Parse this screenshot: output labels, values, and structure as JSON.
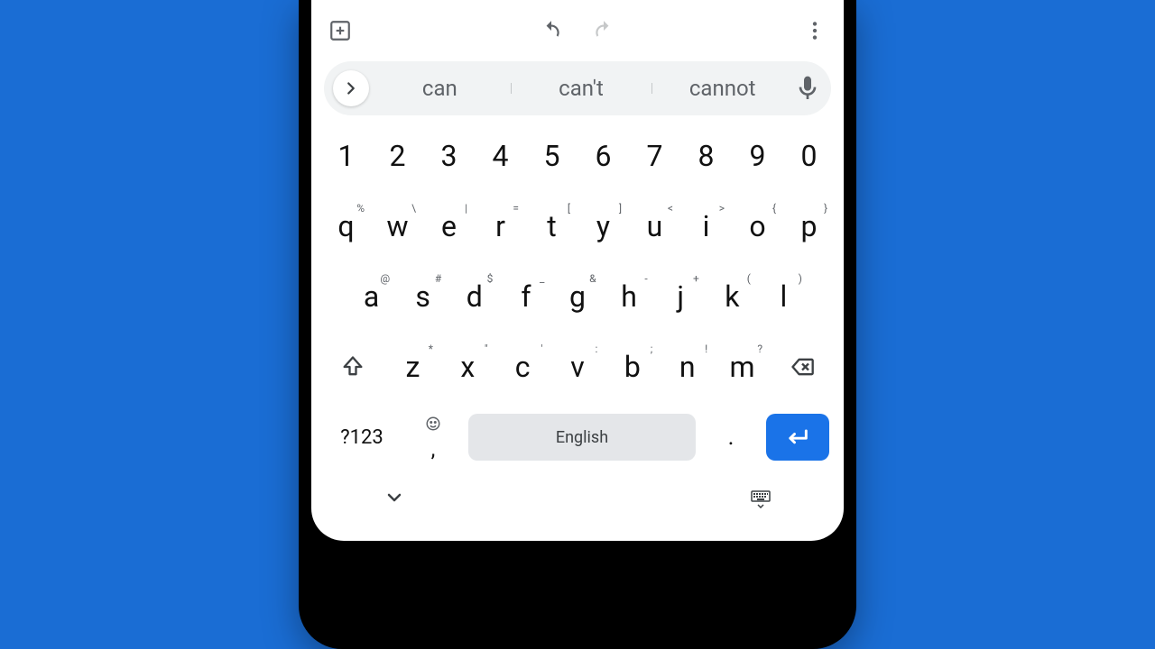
{
  "suggestions": [
    "can",
    "can't",
    "cannot"
  ],
  "rows": {
    "numbers": [
      "1",
      "2",
      "3",
      "4",
      "5",
      "6",
      "7",
      "8",
      "9",
      "0"
    ],
    "row1": [
      {
        "k": "q",
        "a": "%"
      },
      {
        "k": "w",
        "a": "\\"
      },
      {
        "k": "e",
        "a": "|"
      },
      {
        "k": "r",
        "a": "="
      },
      {
        "k": "t",
        "a": "["
      },
      {
        "k": "y",
        "a": "]"
      },
      {
        "k": "u",
        "a": "<"
      },
      {
        "k": "i",
        "a": ">"
      },
      {
        "k": "o",
        "a": "{"
      },
      {
        "k": "p",
        "a": "}"
      }
    ],
    "row2": [
      {
        "k": "a",
        "a": "@"
      },
      {
        "k": "s",
        "a": "#"
      },
      {
        "k": "d",
        "a": "$"
      },
      {
        "k": "f",
        "a": "_"
      },
      {
        "k": "g",
        "a": "&"
      },
      {
        "k": "h",
        "a": "-"
      },
      {
        "k": "j",
        "a": "+"
      },
      {
        "k": "k",
        "a": "("
      },
      {
        "k": "l",
        "a": ")"
      }
    ],
    "row3": [
      {
        "k": "z",
        "a": "*"
      },
      {
        "k": "x",
        "a": "\""
      },
      {
        "k": "c",
        "a": "'"
      },
      {
        "k": "v",
        "a": ":"
      },
      {
        "k": "b",
        "a": ";"
      },
      {
        "k": "n",
        "a": "!"
      },
      {
        "k": "m",
        "a": "?"
      }
    ]
  },
  "bottom": {
    "sym": "?123",
    "comma": ",",
    "space": "English",
    "period": "."
  }
}
